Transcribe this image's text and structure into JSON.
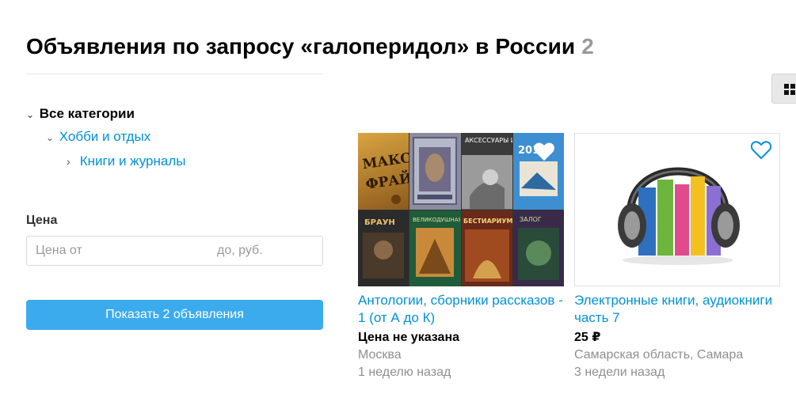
{
  "header": {
    "title": "Объявления по запросу «галоперидол» в России",
    "count": "2"
  },
  "categories": {
    "all": "Все категории",
    "hobby": "Хобби и отдых",
    "books": "Книги и журналы"
  },
  "price": {
    "label": "Цена",
    "from_placeholder": "Цена от",
    "to_placeholder": "до, руб."
  },
  "show_button": "Показать 2 объявления",
  "view_toggle": {
    "icon": "grid-icon",
    "selected": "grid"
  },
  "listings": [
    {
      "title": "Антологии, сборники рассказов - 1 (от А до К)",
      "price": "Цена не указана",
      "location": "Москва",
      "date": "1 неделю назад",
      "favorite_icon": "heart-outline-icon",
      "image": "book-covers-collage"
    },
    {
      "title": "Электронные книги, аудиокниги часть 7",
      "price": "25 ₽",
      "location": "Самарская область, Самара",
      "date": "3 недели назад",
      "favorite_icon": "heart-outline-icon",
      "image": "books-with-headphones",
      "cover_text": {
        "c1_top": "МАКС",
        "c1_bottom": "ФРАЙ",
        "c3": "АКСЕССУАРЫ И АРТЕФАКТЫ",
        "c4": "2015",
        "c5": "БРАУН",
        "c6": "ВЕЛИКОДУШНАЯ ВОЕНА",
        "c7": "БЕСТИАРИУМ",
        "c8": "ЗАЛОГ"
      }
    }
  ],
  "colors": {
    "link": "#0091d9",
    "button": "#3cabee",
    "muted": "#999999",
    "divider": "#e6e6e6"
  }
}
